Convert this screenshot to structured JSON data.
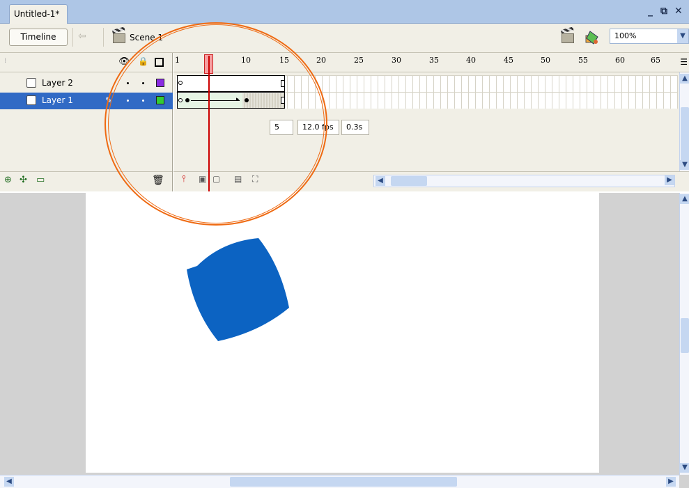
{
  "window": {
    "doc_tab": "Untitled-1*",
    "controls": {
      "minimize": "_",
      "restore": "⧉",
      "close": "✕"
    }
  },
  "scene_bar": {
    "timeline_button": "Timeline",
    "scene_label": "Scene 1",
    "zoom": "100%"
  },
  "timeline": {
    "layers": [
      {
        "name": "Layer 2",
        "color": "#8a2be2",
        "selected": false
      },
      {
        "name": "Layer 1",
        "color": "#33cc33",
        "selected": true
      }
    ],
    "ruler_ticks": [
      "1",
      "5",
      "10",
      "15",
      "20",
      "25",
      "30",
      "35",
      "40",
      "45",
      "50",
      "55",
      "60",
      "65"
    ],
    "current_frame": "5",
    "frame_rate": "12.0 fps",
    "elapsed": "0.3s"
  },
  "stage": {
    "shape_color": "#0c63c2"
  },
  "colors": {
    "highlight": "#ef6a12",
    "selection": "#316ac5"
  }
}
